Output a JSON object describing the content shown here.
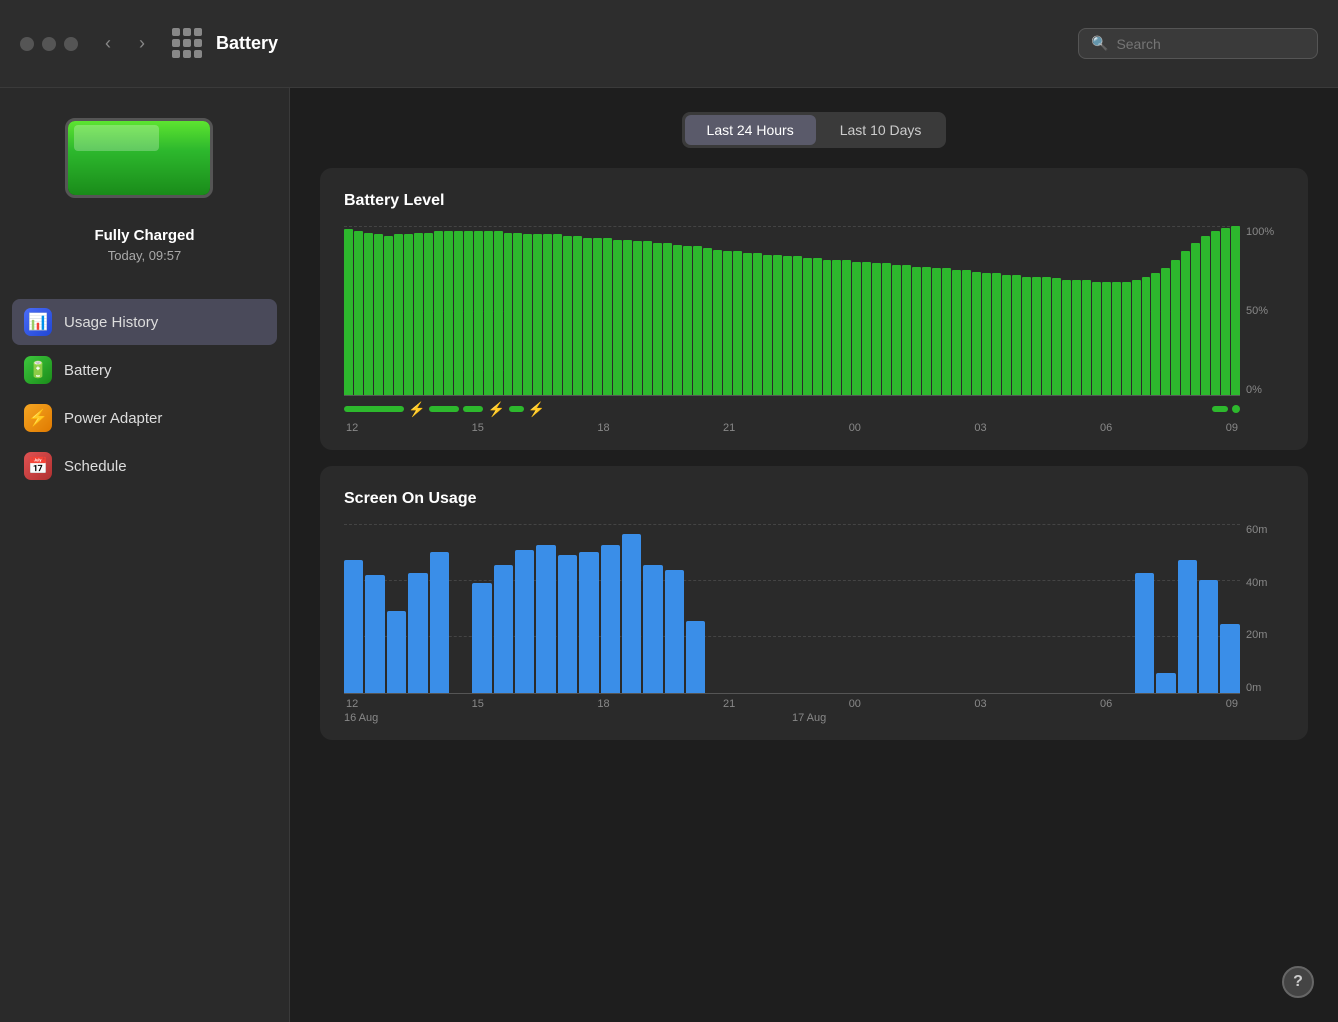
{
  "titlebar": {
    "title": "Battery",
    "search_placeholder": "Search"
  },
  "sidebar": {
    "status": "Fully Charged",
    "time": "Today, 09:57",
    "nav_items": [
      {
        "id": "usage-history",
        "label": "Usage History",
        "icon_type": "usage",
        "icon": "📊",
        "active": true
      },
      {
        "id": "battery",
        "label": "Battery",
        "icon_type": "battery",
        "icon": "🔋",
        "active": false
      },
      {
        "id": "power-adapter",
        "label": "Power Adapter",
        "icon_type": "power",
        "icon": "⚡",
        "active": false
      },
      {
        "id": "schedule",
        "label": "Schedule",
        "icon_type": "schedule",
        "icon": "📅",
        "active": false
      }
    ]
  },
  "tabs": [
    {
      "id": "last-24-hours",
      "label": "Last 24 Hours",
      "active": true
    },
    {
      "id": "last-10-days",
      "label": "Last 10 Days",
      "active": false
    }
  ],
  "battery_level_chart": {
    "title": "Battery Level",
    "y_labels": [
      "100%",
      "50%",
      "0%"
    ],
    "x_labels": [
      "12",
      "15",
      "18",
      "21",
      "00",
      "03",
      "06",
      "09"
    ],
    "bars": [
      98,
      97,
      96,
      95,
      94,
      95,
      95,
      96,
      96,
      97,
      97,
      97,
      97,
      97,
      97,
      97,
      96,
      96,
      95,
      95,
      95,
      95,
      94,
      94,
      93,
      93,
      93,
      92,
      92,
      91,
      91,
      90,
      90,
      89,
      88,
      88,
      87,
      86,
      85,
      85,
      84,
      84,
      83,
      83,
      82,
      82,
      81,
      81,
      80,
      80,
      80,
      79,
      79,
      78,
      78,
      77,
      77,
      76,
      76,
      75,
      75,
      74,
      74,
      73,
      72,
      72,
      71,
      71,
      70,
      70,
      70,
      69,
      68,
      68,
      68,
      67,
      67,
      67,
      67,
      68,
      70,
      72,
      75,
      80,
      85,
      90,
      94,
      97,
      99,
      100
    ]
  },
  "screen_usage_chart": {
    "title": "Screen On Usage",
    "y_labels": [
      "60m",
      "40m",
      "20m",
      "0m"
    ],
    "x_labels": [
      "12",
      "15",
      "18",
      "21",
      "00",
      "03",
      "06",
      "09"
    ],
    "date_labels": [
      "16 Aug",
      "",
      "",
      "",
      "17 Aug",
      "",
      "",
      ""
    ],
    "bars": [
      52,
      46,
      32,
      47,
      55,
      0,
      43,
      50,
      56,
      58,
      54,
      55,
      58,
      62,
      50,
      48,
      28,
      0,
      0,
      0,
      0,
      0,
      0,
      0,
      0,
      0,
      0,
      0,
      0,
      0,
      0,
      0,
      0,
      0,
      0,
      0,
      0,
      47,
      8,
      52,
      44,
      27
    ]
  },
  "help_button_label": "?"
}
